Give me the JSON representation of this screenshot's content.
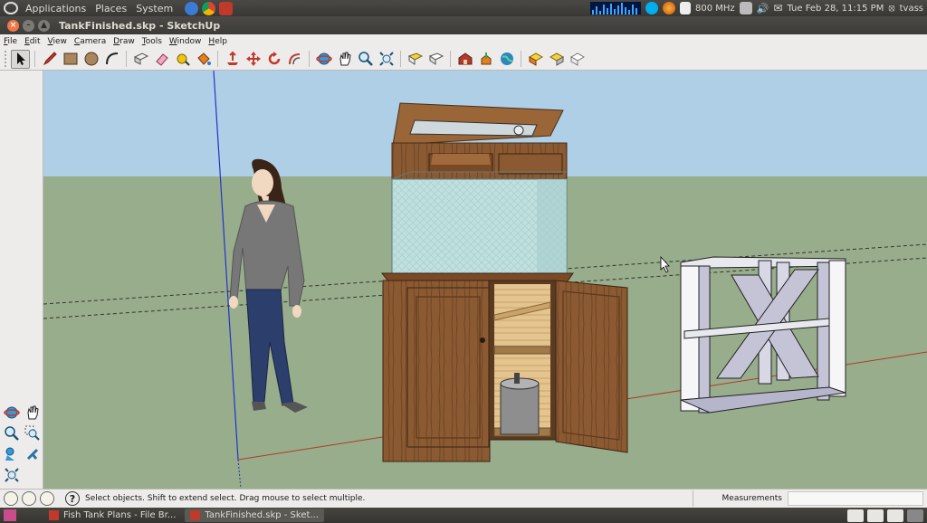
{
  "top_panel": {
    "menus": [
      "Applications",
      "Places",
      "System"
    ],
    "cpu_freq": "800 MHz",
    "datetime": "Tue Feb 28, 11:15 PM",
    "user": "tvass"
  },
  "window": {
    "title": "TankFinished.skp - SketchUp"
  },
  "menubar": [
    "File",
    "Edit",
    "View",
    "Camera",
    "Draw",
    "Tools",
    "Window",
    "Help"
  ],
  "toolbar": {
    "tools": [
      "select",
      "pencil-line",
      "rectangle",
      "circle",
      "arc",
      "make-component",
      "eraser",
      "tape-measure",
      "paint-bucket",
      "push-pull",
      "move",
      "rotate",
      "offset",
      "orbit",
      "pan",
      "zoom",
      "zoom-extents",
      "previous-view",
      "next-view",
      "get-models",
      "share-model",
      "get-photo-texture",
      "google-earth",
      "components",
      "materials",
      "styles"
    ]
  },
  "left_palette": {
    "tools": [
      "orbit",
      "pan",
      "zoom",
      "zoom-window",
      "position-camera",
      "walk",
      "zoom-extents"
    ]
  },
  "statusbar": {
    "message": "Select objects. Shift to extend select. Drag mouse to select multiple.",
    "measurements_label": "Measurements",
    "measurements_value": ""
  },
  "taskbar": {
    "tasks": [
      {
        "label": "Fish Tank Plans - File Br...",
        "active": false
      },
      {
        "label": "TankFinished.skp - Sket...",
        "active": true
      }
    ]
  },
  "colors": {
    "sky": "#aecfe6",
    "ground": "#98ad8b",
    "wood": "#8a5a33",
    "panel_bg": "#3c3b37",
    "toolbar_bg": "#edeceb",
    "close_button": "#f07746"
  }
}
